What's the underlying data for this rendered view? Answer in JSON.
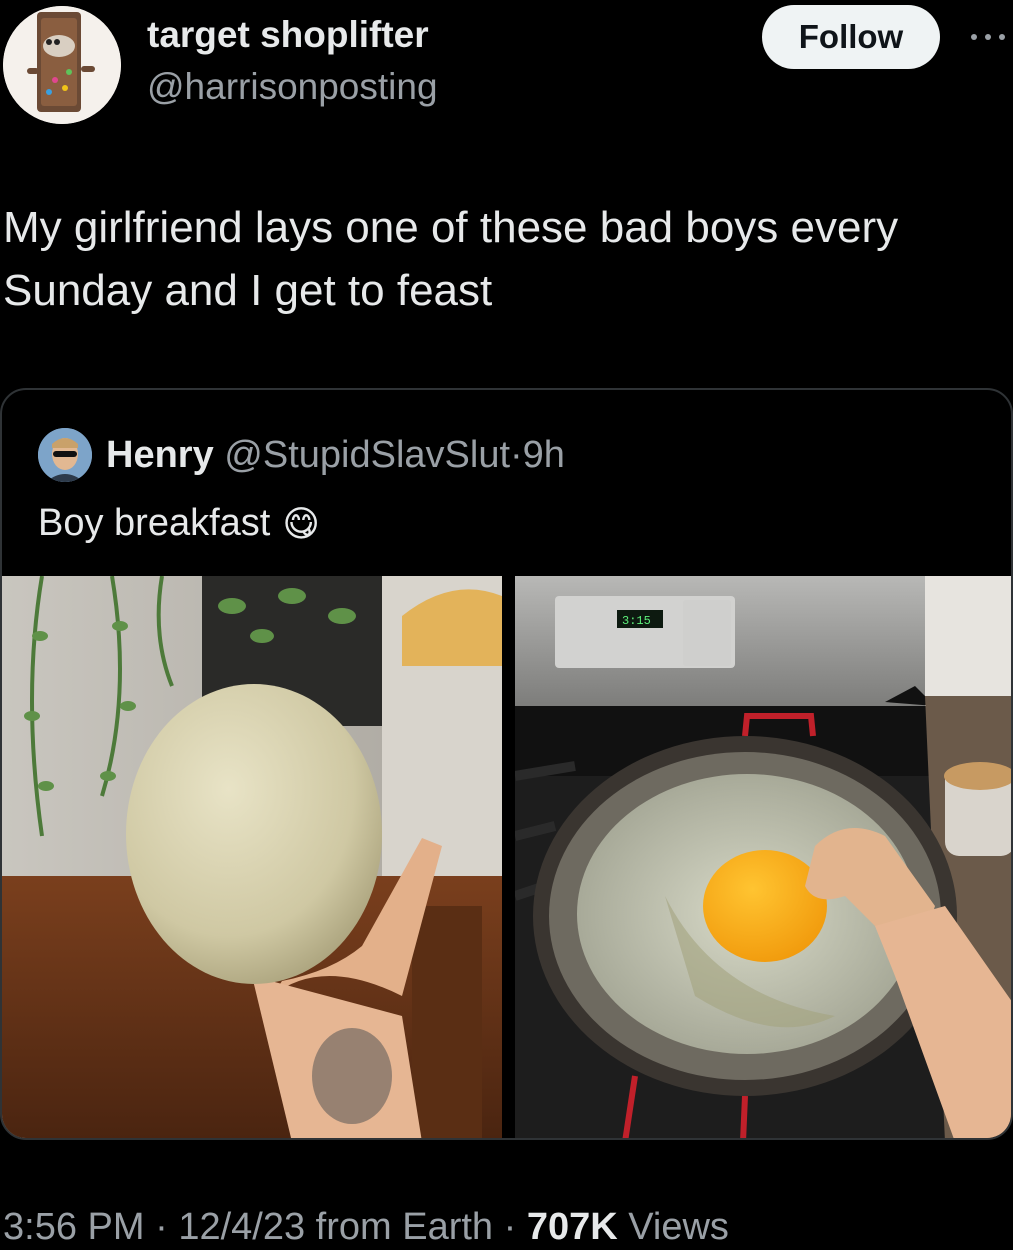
{
  "author": {
    "display_name": "target shoplifter",
    "handle": "@harrisonposting"
  },
  "follow_label": "Follow",
  "more_icon": "more-horizontal-icon",
  "tweet_text": "My girlfriend lays one of these bad boys every Sunday and I get to feast",
  "quote": {
    "name": "Henry",
    "handle": "@StupidSlavSlut",
    "separator": "·",
    "time": "9h",
    "text": "Boy breakfast",
    "emoji": "😋",
    "photos": [
      {
        "name": "ostrich-egg-held-photo"
      },
      {
        "name": "fried-egg-in-pan-photo",
        "stove_display": "3:15"
      }
    ]
  },
  "footer": {
    "time": "3:56 PM",
    "sep1": " · ",
    "date": "12/4/23",
    "source": " from Earth",
    "sep2": " · ",
    "views_count": "707K",
    "views_label": " Views"
  },
  "colors": {
    "background": "#000000",
    "text_primary": "#e7e9ea",
    "text_secondary": "#9aa0a6",
    "border": "#2f3336",
    "follow_bg": "#eff3f4"
  }
}
